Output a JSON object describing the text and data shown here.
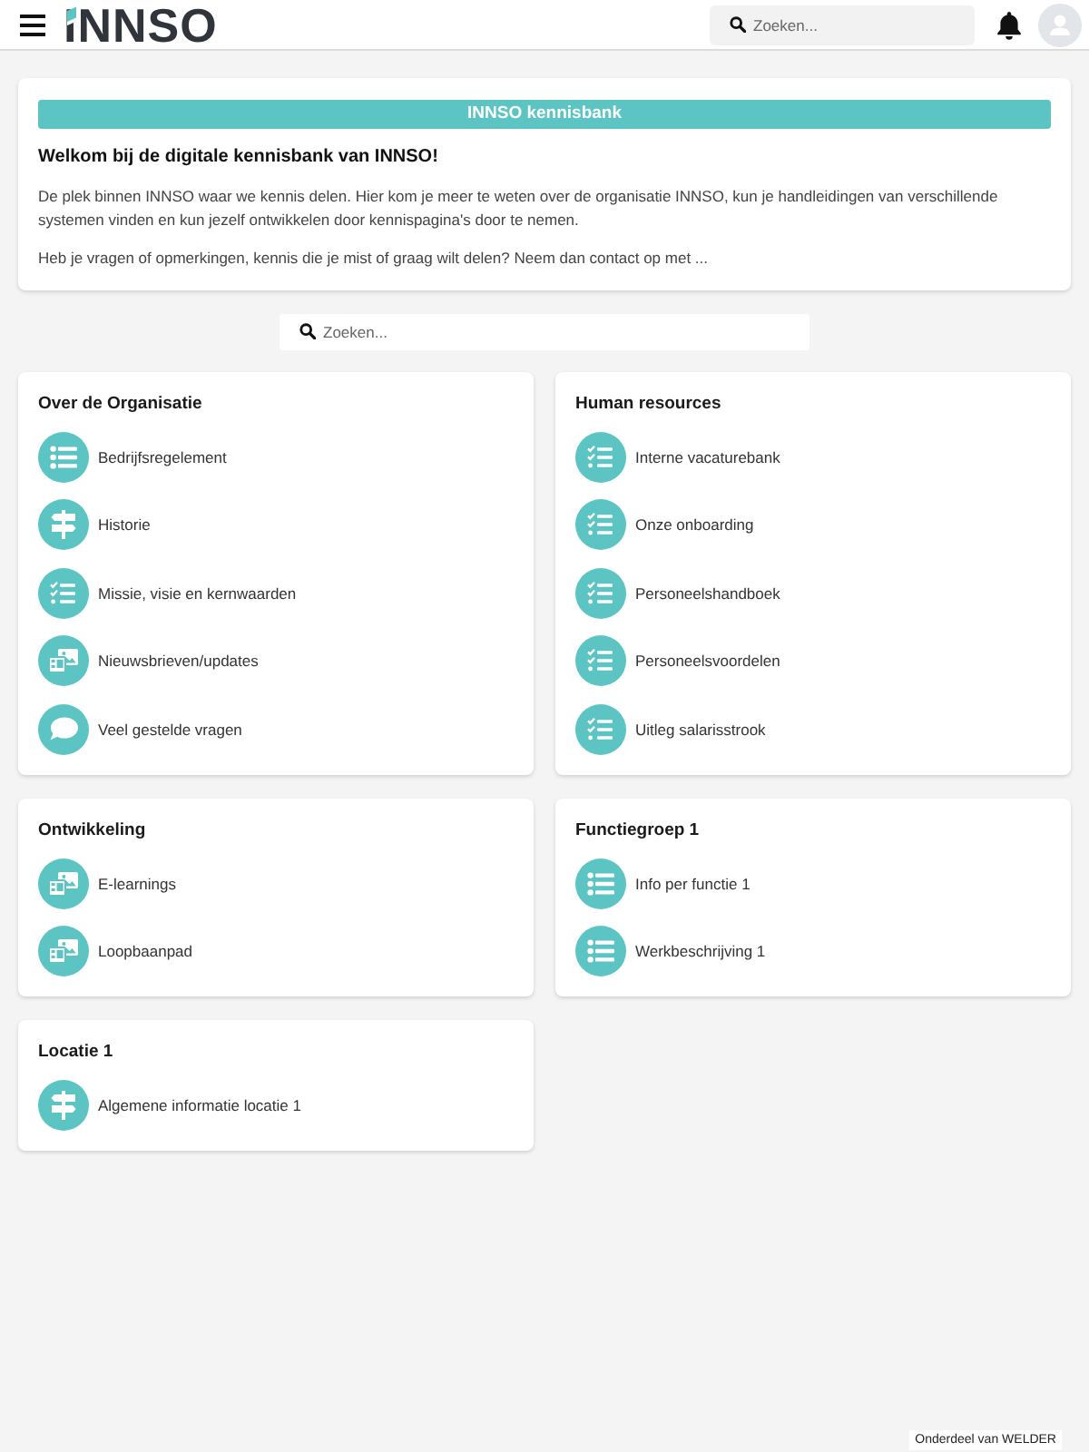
{
  "header": {
    "logo": "INNSO",
    "search": {
      "placeholder": "Zoeken..."
    }
  },
  "intro": {
    "banner": "INNSO kennisbank",
    "heading": "Welkom bij de digitale kennisbank van INNSO!",
    "paragraphs": [
      "De plek binnen INNSO waar we kennis delen. Hier kom je meer te weten over de organisatie INNSO, kun je handleidingen van verschillende systemen vinden en kun jezelf ontwikkelen door kennispagina's door te nemen.",
      "Heb je vragen of opmerkingen, kennis die je mist of graag wilt delen? Neem dan contact op met ..."
    ]
  },
  "search": {
    "placeholder": "Zoeken..."
  },
  "categories": [
    {
      "title": "Over de Organisatie",
      "items": [
        {
          "kind": "list",
          "label": "Bedrijfsregelement"
        },
        {
          "kind": "signpost",
          "label": "Historie"
        },
        {
          "kind": "checklist",
          "label": "Missie, visie en kernwaarden"
        },
        {
          "kind": "images",
          "label": "Nieuwsbrieven/updates"
        },
        {
          "kind": "chat",
          "label": "Veel gestelde vragen"
        }
      ]
    },
    {
      "title": "Human resources",
      "items": [
        {
          "kind": "checklist",
          "label": "Interne vacaturebank"
        },
        {
          "kind": "checklist",
          "label": "Onze onboarding"
        },
        {
          "kind": "checklist",
          "label": "Personeelshandboek"
        },
        {
          "kind": "checklist",
          "label": "Personeelsvoordelen"
        },
        {
          "kind": "checklist",
          "label": "Uitleg salarisstrook"
        }
      ]
    },
    {
      "title": "Ontwikkeling",
      "items": [
        {
          "kind": "images",
          "label": "E-learnings"
        },
        {
          "kind": "images",
          "label": "Loopbaanpad"
        }
      ]
    },
    {
      "title": "Functiegroep 1",
      "items": [
        {
          "kind": "list",
          "label": "Info per functie 1"
        },
        {
          "kind": "list",
          "label": "Werkbeschrijving 1"
        }
      ]
    },
    {
      "title": "Locatie 1",
      "items": [
        {
          "kind": "signpost",
          "label": "Algemene informatie locatie 1"
        }
      ]
    }
  ],
  "footer": "Onderdeel van WELDER"
}
